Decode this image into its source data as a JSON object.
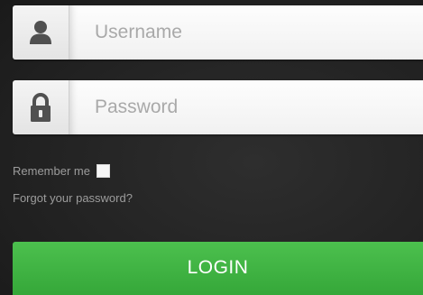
{
  "login_form": {
    "username": {
      "icon": "user-icon",
      "value": "",
      "placeholder": "Username"
    },
    "password": {
      "icon": "lock-icon",
      "value": "",
      "placeholder": "Password"
    },
    "remember_me": {
      "label": "Remember me",
      "checked": false
    },
    "forgot_password_label": "Forgot your password?",
    "login_label": "LOGIN"
  },
  "colors": {
    "background": "#262626",
    "login_button": "#3fb342",
    "icon": "#505050",
    "muted_text": "#9c9c9c"
  }
}
